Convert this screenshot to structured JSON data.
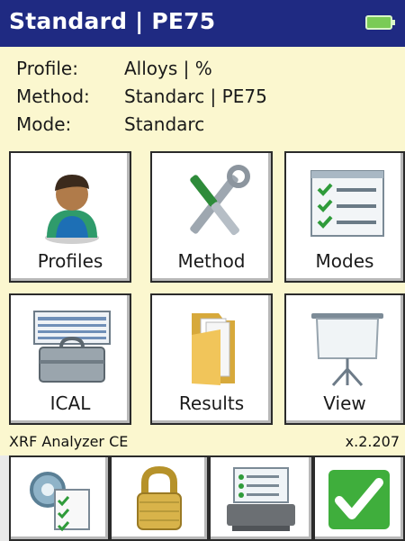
{
  "header": {
    "title": "Standard | PE75",
    "battery_icon": "battery-icon"
  },
  "info": {
    "rows": [
      {
        "label": "Profile:",
        "value": "Alloys | %"
      },
      {
        "label": "Method:",
        "value": "Standarc | PE75"
      },
      {
        "label": "Mode:",
        "value": "Standarc"
      }
    ]
  },
  "tiles": [
    {
      "label": "Profiles",
      "icon": "user-profile-icon"
    },
    {
      "label": "Method",
      "icon": "tools-icon"
    },
    {
      "label": "Modes",
      "icon": "checklist-icon"
    },
    {
      "label": "ICAL",
      "icon": "calibration-case-icon"
    },
    {
      "label": "Results",
      "icon": "folder-icon"
    },
    {
      "label": "View",
      "icon": "projector-screen-icon"
    }
  ],
  "status": {
    "left": "XRF Analyzer CE",
    "right": "x.2.207"
  },
  "bottom_buttons": [
    {
      "icon": "settings-checklist-icon"
    },
    {
      "icon": "lock-icon"
    },
    {
      "icon": "printer-icon"
    },
    {
      "icon": "checkmark-icon"
    }
  ],
  "colors": {
    "title_bar": "#1f2a82",
    "background": "#fbf7cf",
    "check_green": "#3fae3c"
  }
}
